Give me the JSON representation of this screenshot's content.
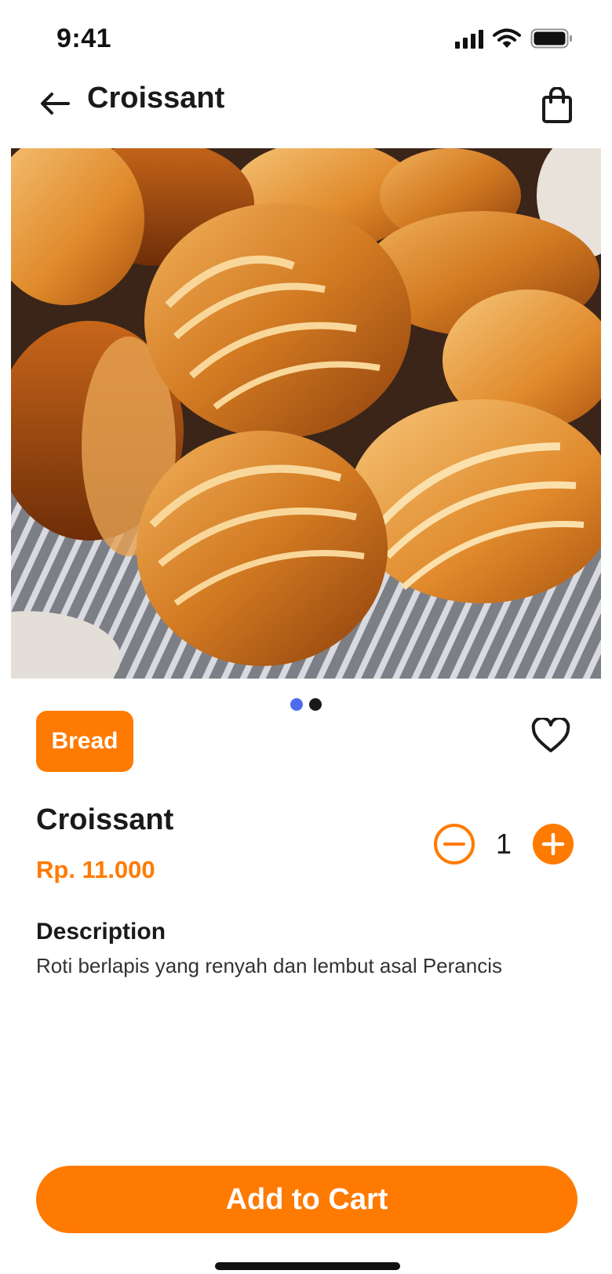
{
  "status_bar": {
    "time": "9:41",
    "icons": [
      "signal-icon",
      "wifi-icon",
      "battery-icon"
    ]
  },
  "header": {
    "title": "Croissant",
    "back_icon": "arrow-left-icon",
    "cart_icon": "shopping-bag-icon"
  },
  "carousel": {
    "total": 2,
    "active_index": 0,
    "active_color": "#4F6BED",
    "inactive_color": "#1A1A1A"
  },
  "product": {
    "category": "Bread",
    "name": "Croissant",
    "price": "Rp. 11.000",
    "quantity": "1",
    "description_heading": "Description",
    "description": "Roti berlapis yang renyah dan lembut asal Perancis"
  },
  "actions": {
    "add_to_cart_label": "Add to Cart",
    "favorite_icon": "heart-outline-icon",
    "decrement_icon": "minus-circle-icon",
    "increment_icon": "plus-circle-icon"
  },
  "colors": {
    "accent": "#FF7A00",
    "text": "#1A1A1A"
  }
}
